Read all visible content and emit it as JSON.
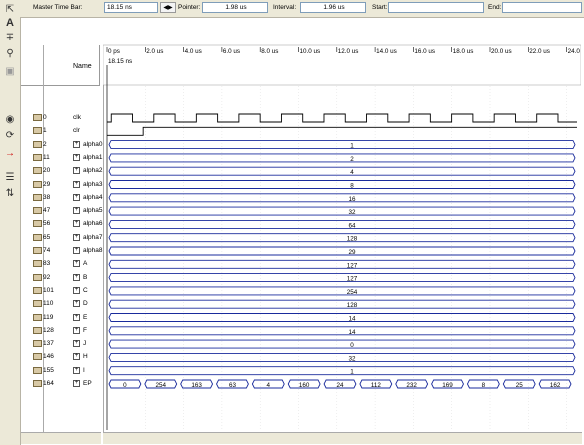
{
  "header": {
    "master_label": "Master Time Bar:",
    "master_value": "18.15 ns",
    "pointer_label": "Pointer:",
    "pointer_value": "1.98 us",
    "interval_label": "Interval:",
    "interval_value": "1.96 us",
    "start_label": "Start:",
    "start_value": "",
    "end_label": "End:",
    "end_value": ""
  },
  "columns": {
    "name": "Name"
  },
  "timeline": {
    "ticks": [
      "0 ps",
      "2.0 us",
      "4.0 us",
      "6.0 us",
      "8.0 us",
      "10.0 us",
      "12.0 us",
      "14.0 us",
      "16.0 us",
      "18.0 us",
      "20.0 us",
      "22.0 us",
      "24.0 us"
    ],
    "marker_label": "18.15 ns"
  },
  "signals": [
    {
      "index": "0",
      "name": "clk",
      "bus": false,
      "value": "",
      "wave": "clock"
    },
    {
      "index": "1",
      "name": "clr",
      "bus": false,
      "value": "",
      "wave": "step"
    },
    {
      "index": "2",
      "name": "alpha0",
      "bus": true,
      "value": "1"
    },
    {
      "index": "11",
      "name": "alpha1",
      "bus": true,
      "value": "2"
    },
    {
      "index": "20",
      "name": "alpha2",
      "bus": true,
      "value": "4"
    },
    {
      "index": "29",
      "name": "alpha3",
      "bus": true,
      "value": "8"
    },
    {
      "index": "38",
      "name": "alpha4",
      "bus": true,
      "value": "16"
    },
    {
      "index": "47",
      "name": "alpha5",
      "bus": true,
      "value": "32"
    },
    {
      "index": "56",
      "name": "alpha6",
      "bus": true,
      "value": "64"
    },
    {
      "index": "65",
      "name": "alpha7",
      "bus": true,
      "value": "128"
    },
    {
      "index": "74",
      "name": "alpha8",
      "bus": true,
      "value": "29"
    },
    {
      "index": "83",
      "name": "A",
      "bus": true,
      "value": "127"
    },
    {
      "index": "92",
      "name": "B",
      "bus": true,
      "value": "127"
    },
    {
      "index": "101",
      "name": "C",
      "bus": true,
      "value": "254"
    },
    {
      "index": "110",
      "name": "D",
      "bus": true,
      "value": "128"
    },
    {
      "index": "119",
      "name": "E",
      "bus": true,
      "value": "14"
    },
    {
      "index": "128",
      "name": "F",
      "bus": true,
      "value": "14"
    },
    {
      "index": "137",
      "name": "J",
      "bus": true,
      "value": "0"
    },
    {
      "index": "146",
      "name": "H",
      "bus": true,
      "value": "32"
    },
    {
      "index": "155",
      "name": "I",
      "bus": true,
      "value": "1"
    },
    {
      "index": "164",
      "name": "EP",
      "bus": true,
      "value": "",
      "segments": [
        "0",
        "254",
        "163",
        "63",
        "4",
        "160",
        "24",
        "112",
        "232",
        "169",
        "8",
        "25",
        "162"
      ]
    }
  ],
  "toolbar_icons": [
    "pointer-icon",
    "text-icon",
    "waveform-edit-icon",
    "zoom-icon",
    "full-screen-icon",
    "find-icon",
    "replace-icon",
    "overwrite-icon",
    "sort-icon"
  ],
  "colors": {
    "bus": "#1a2b9c",
    "wave": "#000000",
    "grid": "#dddddd",
    "panel": "#ece9d8"
  }
}
